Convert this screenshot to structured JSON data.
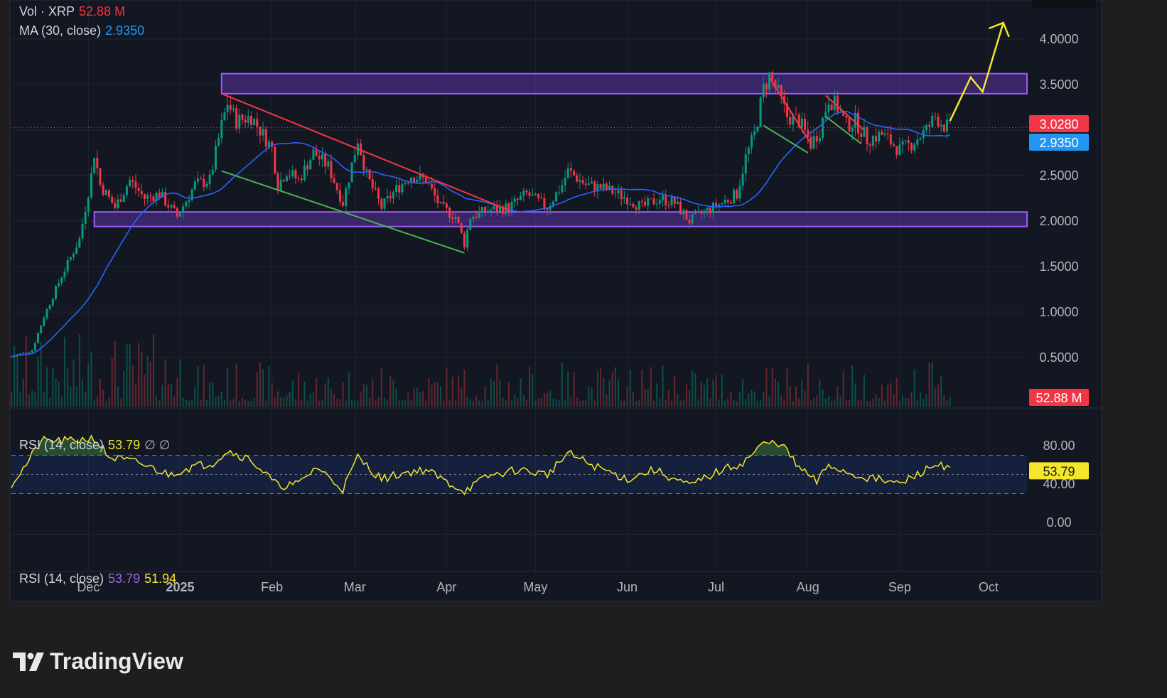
{
  "chart_data": {
    "type": "candlestick",
    "symbol": "XRP",
    "volume_legend": {
      "label": "Vol · XRP",
      "value": "52.88 M"
    },
    "ma_legend": {
      "label": "MA (30, close)",
      "value": "2.9350"
    },
    "rsi_legend": {
      "label": "RSI (14, close)",
      "value": "53.79",
      "marks": "∅ ∅"
    },
    "rsi2_legend": {
      "label": "RSI (14, close)",
      "value": "53.79",
      "value2": "51.94"
    },
    "price_axis_ticks": [
      "4.0000",
      "3.5000",
      "2.5000",
      "2.0000",
      "1.5000",
      "1.0000",
      "0.5000"
    ],
    "price_ticks_values": [
      4.0,
      3.5,
      2.5,
      2.0,
      1.5,
      1.0,
      0.5
    ],
    "price_ylim": [
      0.0,
      4.3
    ],
    "rsi_axis_ticks": [
      "80.00",
      "40.00",
      "0.00"
    ],
    "rsi_ticks_values": [
      80,
      40,
      0
    ],
    "rsi_ylim": [
      0,
      100
    ],
    "rsi_bands": [
      70,
      50,
      30
    ],
    "price_badges": [
      {
        "label": "3.0280",
        "value": 3.028,
        "color": "#f23645"
      },
      {
        "label": "2.9350",
        "value": 2.935,
        "color": "#2196f3"
      }
    ],
    "volume_badge": {
      "label": "52.88 M",
      "color": "#f23645"
    },
    "rsi_badge": {
      "label": "53.79",
      "value": 53.79,
      "color": "#f5e62b"
    },
    "x_axis_labels": [
      {
        "label": "Dec",
        "date": "2024-12-01"
      },
      {
        "label": "2025",
        "date": "2025-01-01"
      },
      {
        "label": "Feb",
        "date": "2025-02-01"
      },
      {
        "label": "Mar",
        "date": "2025-03-01"
      },
      {
        "label": "Apr",
        "date": "2025-04-01"
      },
      {
        "label": "May",
        "date": "2025-05-01"
      },
      {
        "label": "Jun",
        "date": "2025-06-01"
      },
      {
        "label": "Jul",
        "date": "2025-07-01"
      },
      {
        "label": "Aug",
        "date": "2025-08-01"
      },
      {
        "label": "Sep",
        "date": "2025-09-01"
      },
      {
        "label": "Oct",
        "date": "2025-10-01"
      }
    ],
    "x_range": [
      "2024-11-05",
      "2025-10-14"
    ],
    "last_date": "2025-09-18",
    "close_anchors": [
      [
        "2024-11-05",
        0.51
      ],
      [
        "2024-11-12",
        0.58
      ],
      [
        "2024-11-16",
        0.95
      ],
      [
        "2024-11-22",
        1.4
      ],
      [
        "2024-11-28",
        1.8
      ],
      [
        "2024-12-02",
        2.5
      ],
      [
        "2024-12-03",
        2.75
      ],
      [
        "2024-12-05",
        2.4
      ],
      [
        "2024-12-10",
        2.15
      ],
      [
        "2024-12-15",
        2.45
      ],
      [
        "2024-12-20",
        2.25
      ],
      [
        "2024-12-25",
        2.3
      ],
      [
        "2024-12-31",
        2.05
      ],
      [
        "2025-01-06",
        2.4
      ],
      [
        "2025-01-11",
        2.45
      ],
      [
        "2025-01-15",
        3.05
      ],
      [
        "2025-01-17",
        3.3
      ],
      [
        "2025-01-20",
        3.1
      ],
      [
        "2025-01-25",
        3.15
      ],
      [
        "2025-01-28",
        3.0
      ],
      [
        "2025-02-01",
        2.8
      ],
      [
        "2025-02-03",
        2.4
      ],
      [
        "2025-02-06",
        2.55
      ],
      [
        "2025-02-10",
        2.45
      ],
      [
        "2025-02-15",
        2.75
      ],
      [
        "2025-02-20",
        2.6
      ],
      [
        "2025-02-25",
        2.2
      ],
      [
        "2025-03-02",
        2.9
      ],
      [
        "2025-03-05",
        2.5
      ],
      [
        "2025-03-10",
        2.15
      ],
      [
        "2025-03-15",
        2.35
      ],
      [
        "2025-03-20",
        2.5
      ],
      [
        "2025-03-25",
        2.45
      ],
      [
        "2025-03-30",
        2.15
      ],
      [
        "2025-04-04",
        2.05
      ],
      [
        "2025-04-07",
        1.75
      ],
      [
        "2025-04-09",
        2.05
      ],
      [
        "2025-04-15",
        2.12
      ],
      [
        "2025-04-22",
        2.15
      ],
      [
        "2025-04-28",
        2.3
      ],
      [
        "2025-05-05",
        2.15
      ],
      [
        "2025-05-10",
        2.4
      ],
      [
        "2025-05-12",
        2.55
      ],
      [
        "2025-05-18",
        2.4
      ],
      [
        "2025-05-25",
        2.35
      ],
      [
        "2025-06-01",
        2.25
      ],
      [
        "2025-06-06",
        2.15
      ],
      [
        "2025-06-12",
        2.25
      ],
      [
        "2025-06-17",
        2.2
      ],
      [
        "2025-06-22",
        2.0
      ],
      [
        "2025-06-27",
        2.1
      ],
      [
        "2025-07-03",
        2.2
      ],
      [
        "2025-07-08",
        2.3
      ],
      [
        "2025-07-11",
        2.7
      ],
      [
        "2025-07-14",
        2.95
      ],
      [
        "2025-07-17",
        3.45
      ],
      [
        "2025-07-19",
        3.6
      ],
      [
        "2025-07-22",
        3.4
      ],
      [
        "2025-07-25",
        3.15
      ],
      [
        "2025-07-29",
        3.1
      ],
      [
        "2025-08-02",
        2.85
      ],
      [
        "2025-08-05",
        3.0
      ],
      [
        "2025-08-08",
        3.35
      ],
      [
        "2025-08-11",
        3.25
      ],
      [
        "2025-08-14",
        3.05
      ],
      [
        "2025-08-17",
        3.1
      ],
      [
        "2025-08-21",
        2.9
      ],
      [
        "2025-08-26",
        2.95
      ],
      [
        "2025-09-01",
        2.78
      ],
      [
        "2025-09-05",
        2.85
      ],
      [
        "2025-09-10",
        3.0
      ],
      [
        "2025-09-13",
        3.15
      ],
      [
        "2025-09-16",
        3.05
      ],
      [
        "2025-09-18",
        3.028
      ]
    ],
    "rsi_anchors": [
      [
        "2024-11-05",
        40
      ],
      [
        "2024-11-10",
        60
      ],
      [
        "2024-11-15",
        85
      ],
      [
        "2024-11-25",
        85
      ],
      [
        "2024-12-03",
        88
      ],
      [
        "2024-12-08",
        68
      ],
      [
        "2024-12-18",
        62
      ],
      [
        "2024-12-28",
        50
      ],
      [
        "2025-01-05",
        58
      ],
      [
        "2025-01-12",
        62
      ],
      [
        "2025-01-17",
        75
      ],
      [
        "2025-01-25",
        65
      ],
      [
        "2025-02-03",
        38
      ],
      [
        "2025-02-10",
        40
      ],
      [
        "2025-02-16",
        58
      ],
      [
        "2025-02-25",
        35
      ],
      [
        "2025-03-02",
        68
      ],
      [
        "2025-03-10",
        45
      ],
      [
        "2025-03-18",
        52
      ],
      [
        "2025-03-25",
        55
      ],
      [
        "2025-04-01",
        42
      ],
      [
        "2025-04-07",
        33
      ],
      [
        "2025-04-15",
        48
      ],
      [
        "2025-04-25",
        55
      ],
      [
        "2025-05-05",
        50
      ],
      [
        "2025-05-12",
        72
      ],
      [
        "2025-05-20",
        60
      ],
      [
        "2025-06-01",
        45
      ],
      [
        "2025-06-10",
        55
      ],
      [
        "2025-06-22",
        38
      ],
      [
        "2025-07-01",
        52
      ],
      [
        "2025-07-10",
        62
      ],
      [
        "2025-07-17",
        82
      ],
      [
        "2025-07-23",
        83
      ],
      [
        "2025-07-28",
        60
      ],
      [
        "2025-08-04",
        42
      ],
      [
        "2025-08-08",
        60
      ],
      [
        "2025-08-16",
        50
      ],
      [
        "2025-08-24",
        45
      ],
      [
        "2025-09-01",
        40
      ],
      [
        "2025-09-10",
        55
      ],
      [
        "2025-09-15",
        62
      ],
      [
        "2025-09-18",
        53.79
      ]
    ],
    "zones": [
      {
        "name": "resistance-zone",
        "range": [
          3.4,
          3.62
        ],
        "start": "2025-01-15",
        "end": "2025-10-14"
      },
      {
        "name": "support-zone",
        "range": [
          1.94,
          2.1
        ],
        "start": "2024-12-03",
        "end": "2025-10-14"
      }
    ],
    "trendlines": [
      {
        "color": "#f23645",
        "points": [
          [
            "2025-01-15",
            3.4
          ],
          [
            "2025-04-22",
            2.12
          ]
        ]
      },
      {
        "color": "#4caf50",
        "points": [
          [
            "2025-01-15",
            2.55
          ],
          [
            "2025-04-07",
            1.65
          ]
        ]
      },
      {
        "color": "#f23645",
        "points": [
          [
            "2025-07-19",
            3.58
          ],
          [
            "2025-08-02",
            2.85
          ]
        ]
      },
      {
        "color": "#4caf50",
        "points": [
          [
            "2025-07-17",
            3.05
          ],
          [
            "2025-08-01",
            2.75
          ]
        ]
      },
      {
        "color": "#f23645",
        "points": [
          [
            "2025-08-07",
            3.38
          ],
          [
            "2025-08-20",
            3.0
          ]
        ]
      },
      {
        "color": "#4caf50",
        "points": [
          [
            "2025-08-07",
            3.15
          ],
          [
            "2025-08-19",
            2.85
          ]
        ]
      }
    ],
    "projection": {
      "color": "#f5e62b",
      "points": [
        [
          "2025-09-18",
          3.1
        ],
        [
          "2025-09-25",
          3.58
        ],
        [
          "2025-09-29",
          3.42
        ],
        [
          "2025-10-06",
          4.18
        ]
      ]
    },
    "colors": {
      "up": "#089981",
      "down": "#f23645",
      "ma": "#2962ff",
      "rsi": "#f5e62b",
      "zone": "#7b3fe4"
    }
  },
  "brand": {
    "name": "TradingView"
  }
}
